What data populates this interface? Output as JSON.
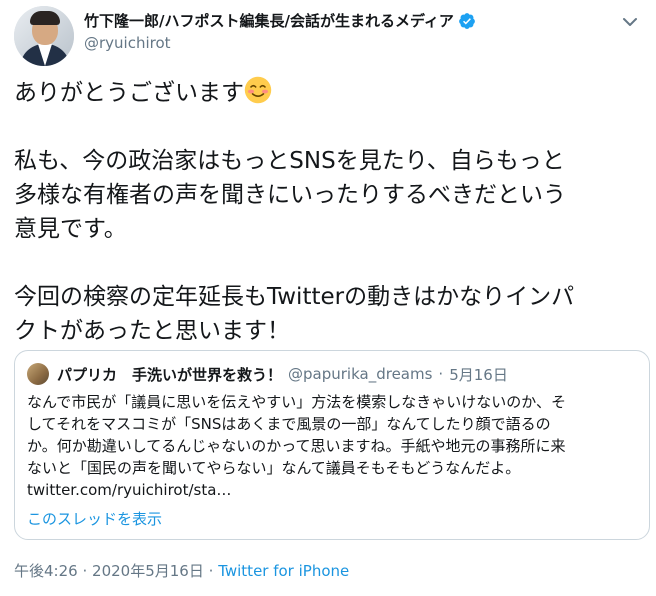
{
  "user": {
    "display_name": "竹下隆一郎/ハフポスト編集長/会話が生まれるメディア",
    "handle": "@ryuichirot"
  },
  "tweet": {
    "line1": "ありがとうございます",
    "paragraph2": "私も、今の政治家はもっとSNSを見たり、自らもっと\n多様な有権者の声を聞きにいったりするべきだという\n意見です。",
    "paragraph3": "今回の検察の定年延長もTwitterの動きはかなりインパ\nクトがあったと思います！"
  },
  "quoted_tweet": {
    "display_name": "パプリカ　手洗いが世界を救う！",
    "handle": "@papurika_dreams",
    "separator": "·",
    "date": "5月16日",
    "body": "なんで市民が「議員に思いを伝えやすい」方法を模索しなきゃいけないのか、そ\nしてそれをマスコミが「SNSはあくまで風景の一部」なんてしたり顔で語るの\nか。何か勘違いしてるんじゃないのかって思いますね。手紙や地元の事務所に来\nないと「国民の声を聞いてやらない」なんて議員そもそもどうなんだよ。\ntwitter.com/ryuichirot/sta…",
    "show_thread": "このスレッドを表示"
  },
  "meta": {
    "time": "午後4:26",
    "separator": "·",
    "date": "2020年5月16日",
    "source": "Twitter for iPhone"
  },
  "colors": {
    "link": "#1b95e0",
    "muted": "#657786",
    "verified": "#1da1f2",
    "border": "#ccd6dd"
  },
  "icons": {
    "verified": "verified-badge-icon",
    "caret": "chevron-down-icon",
    "emoji": "smiling-face-with-smiling-eyes-emoji"
  }
}
